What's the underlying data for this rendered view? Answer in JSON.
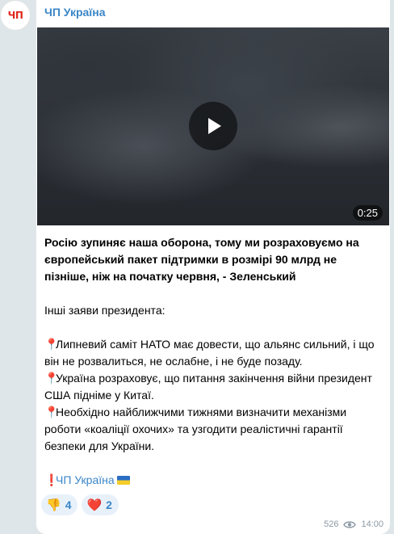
{
  "channel": {
    "avatar_text": "ЧП",
    "name": "ЧП Україна"
  },
  "video": {
    "duration": "0:25",
    "play_icon": "play-icon"
  },
  "message": {
    "headline": "Росію зупиняє наша оборона, тому ми розраховуємо на європейський пакет підтримки в розмірі 90 млрд не пізніше, ніж на початку червня, - Зеленський",
    "intro": "Інші заяви президента:",
    "points": [
      "Липневий саміт НАТО має довести, що альянс сильний, і що він не розвалиться, не ослабне, і не буде позаду.",
      "Україна розраховує, що питання закінчення війни президент США підніме у Китаї.",
      "Необхідно найближчими тижнями визначити механізми роботи «коаліції охочих» та узгодити реалістичні гарантії безпеки для України."
    ],
    "signature": "ЧП Україна"
  },
  "reactions": [
    {
      "emoji": "👎",
      "count": "4",
      "icon": "thumbs-down-icon"
    },
    {
      "emoji": "❤️",
      "count": "2",
      "icon": "heart-icon"
    }
  ],
  "meta": {
    "views": "526",
    "time": "14:00"
  },
  "colors": {
    "accent": "#3a86c8",
    "brand": "#e0261d",
    "background": "#dfe6ea"
  }
}
